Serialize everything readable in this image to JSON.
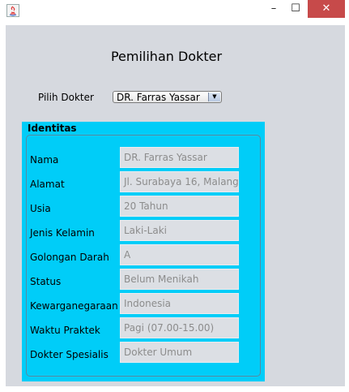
{
  "window": {
    "icon": "java-icon",
    "controls": {
      "minimize": "–",
      "maximize": "☐",
      "close": "✕"
    }
  },
  "header": {
    "title": "Pemilihan Dokter"
  },
  "selector": {
    "label": "Pilih Dokter",
    "selected": "DR. Farras Yassar"
  },
  "identity": {
    "title": "Identitas",
    "accent_color": "#00cdf8",
    "rows": [
      {
        "label": "Nama",
        "value": "DR. Farras Yassar"
      },
      {
        "label": "Alamat",
        "value": "Jl. Surabaya 16, Malang"
      },
      {
        "label": "Usia",
        "value": "20 Tahun"
      },
      {
        "label": "Jenis Kelamin",
        "value": "Laki-Laki"
      },
      {
        "label": "Golongan Darah",
        "value": "A"
      },
      {
        "label": "Status",
        "value": "Belum Menikah"
      },
      {
        "label": "Kewarganegaraan",
        "value": "Indonesia"
      },
      {
        "label": "Waktu Praktek",
        "value": " Pagi (07.00-15.00)"
      },
      {
        "label": "Dokter Spesialis",
        "value": "Dokter Umum"
      }
    ]
  }
}
